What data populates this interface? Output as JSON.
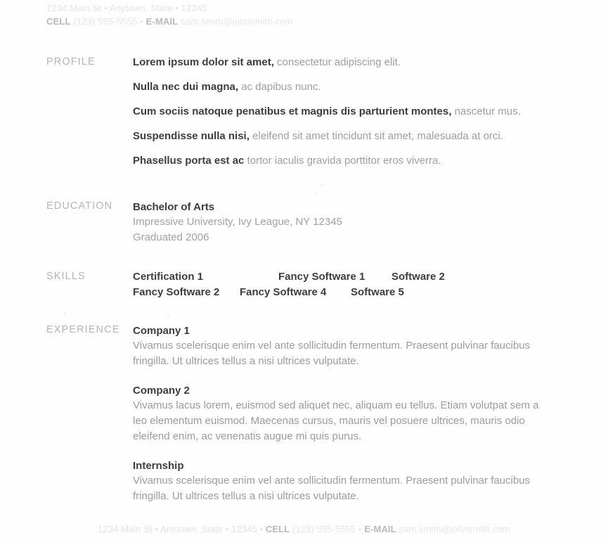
{
  "document": {
    "type": "resume",
    "background_color": "#fefefe",
    "heading_color": "#3b3e41",
    "body_color": "#9d9fa1",
    "label_color": "#b2b4b6",
    "faded_color": "#e3e4e5"
  },
  "contact": {
    "address": "1234 Main St • Anytown, State • 12345",
    "cell_label": "CELL",
    "cell_value": "(123) 555-5555",
    "separator": "•",
    "email_label": "E-MAIL",
    "email_value": "sam.smith@johnsmith.com",
    "footer_line": "1234 Main St • Anytown, State • 12345 •",
    "footer_cell_label": "CELL",
    "footer_cell_value": "(123) 555-5555 •",
    "footer_email_label": "E-MAIL",
    "footer_email_value": "sam.smith@johnsmith.com"
  },
  "sections": {
    "profile": {
      "label": "PROFILE",
      "lines": [
        {
          "bold": "Lorem ipsum dolor sit amet,",
          "rest": " consectetur adipiscing elit."
        },
        {
          "bold": "Nulla nec dui magna,",
          "rest": " ac dapibus nunc."
        },
        {
          "bold": "Cum sociis natoque penatibus et magnis dis parturient montes,",
          "rest": " nascetur mus."
        },
        {
          "bold": "Suspendisse nulla nisi,",
          "rest": " eleifend sit amet tincidunt sit amet, malesuada at orci."
        },
        {
          "bold": "Phasellus porta est ac",
          "rest": " tortor iaculis gravida porttitor eros viverra."
        }
      ]
    },
    "education": {
      "label": "EDUCATION",
      "degree": "Bachelor of Arts",
      "school": "Impressive University, Ivy League, NY 12345",
      "graduated": "Graduated 2006"
    },
    "skills": {
      "label": "SKILLS",
      "rows": [
        [
          "Certification 1",
          "Fancy Software 1",
          "Software 2"
        ],
        [
          "Fancy Software 2",
          "Fancy Software 4",
          "Software 5"
        ]
      ]
    },
    "experience": {
      "label": "EXPERIENCE",
      "entries": [
        {
          "title": "Company 1",
          "description": "Vivamus scelerisque enim vel ante sollicitudin fermentum. Praesent pulvinar faucibus fringilla. Ut ultrices tellus a nisi ultrices vulputate."
        },
        {
          "title": "Company 2",
          "description": "Vivamus lacus lorem, euismod sed aliquet nec, aliquam eu tellus. Etiam volutpat sem a leo elementum euismod. Maecenas cursus, mauris vel posuere ultrices, mauris odio eleifend enim, ac venenatis augue mi quis purus."
        },
        {
          "title": "Internship",
          "description": "Vivamus scelerisque enim vel ante sollicitudin fermentum. Praesent pulvinar faucibus fringilla. Ut ultrices tellus a nisi ultrices vulputate."
        }
      ]
    }
  }
}
